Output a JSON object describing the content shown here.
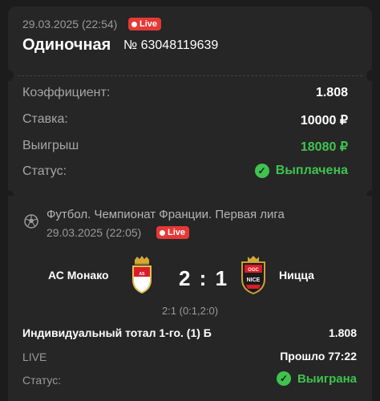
{
  "bet": {
    "datetime": "29.03.2025 (22:54)",
    "live_label": "Live",
    "type": "Одиночная",
    "number": "№ 63048119639"
  },
  "summary": {
    "coef_label": "Коэффициент:",
    "coef_value": "1.808",
    "stake_label": "Ставка:",
    "stake_value": "10000 ₽",
    "win_label": "Выигрыш",
    "win_value": "18080 ₽",
    "status_label": "Статус:",
    "status_value": "Выплачена"
  },
  "event": {
    "league": "Футбол. Чемпионат Франции. Первая лига",
    "datetime": "29.03.2025 (22:05)",
    "live_label": "Live",
    "home_team": "АС Монако",
    "away_team": "Ницца",
    "score": "2 : 1",
    "score_detail": "2:1 (0:1,2:0)",
    "market": "Индивидуальный тотал 1-го. (1) Б",
    "market_coef": "1.808",
    "live_tag": "LIVE",
    "elapsed": "Прошло 77:22",
    "status_label": "Статус:",
    "status_value": "Выиграна"
  },
  "colors": {
    "background": "#1c1c1c",
    "card": "#262626",
    "accent_green": "#3fc34f",
    "live_red": "#e53935"
  }
}
